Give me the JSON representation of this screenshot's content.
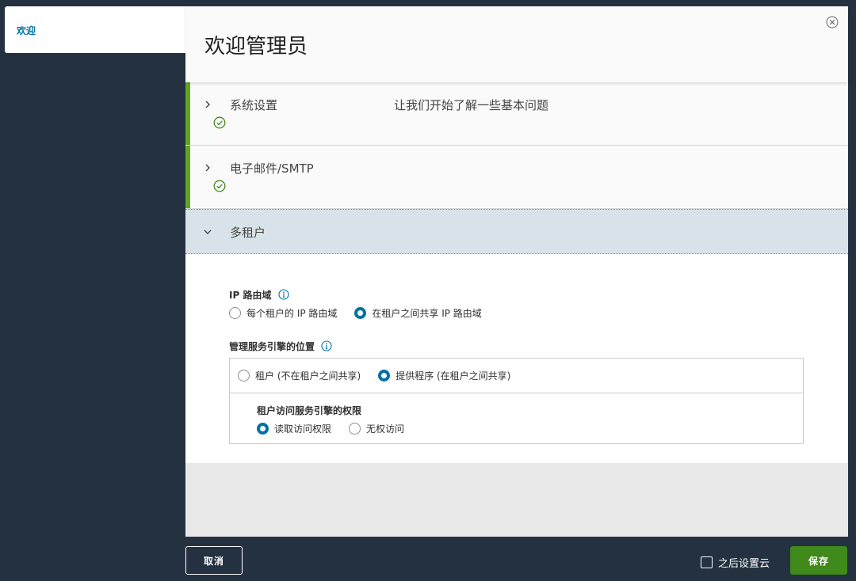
{
  "sidebar": {
    "items": [
      {
        "label": "欢迎"
      }
    ]
  },
  "modal": {
    "title": "欢迎管理员"
  },
  "steps": [
    {
      "title": "系统设置",
      "description": "让我们开始了解一些基本问题",
      "status": "done"
    },
    {
      "title": "电子邮件/SMTP",
      "status": "done"
    },
    {
      "title": "多租户",
      "status": "active"
    }
  ],
  "ip_route": {
    "label": "IP 路由域",
    "options": [
      {
        "label": "每个租户的 IP 路由域",
        "selected": false
      },
      {
        "label": "在租户之间共享 IP 路由域",
        "selected": true
      }
    ]
  },
  "service_engine": {
    "label": "管理服务引擎的位置",
    "options": [
      {
        "label": "租户 (不在租户之间共享)",
        "selected": false
      },
      {
        "label": "提供程序 (在租户之间共享)",
        "selected": true
      }
    ],
    "access": {
      "label": "租户访问服务引擎的权限",
      "options": [
        {
          "label": "读取访问权限",
          "selected": true
        },
        {
          "label": "无权访问",
          "selected": false
        }
      ]
    }
  },
  "footer": {
    "cancel_label": "取消",
    "later_label": "之后设置云",
    "save_label": "保存"
  },
  "colors": {
    "accent": "#0072a3",
    "success": "#62a420",
    "save": "#3f8a1a",
    "background": "#233140"
  }
}
